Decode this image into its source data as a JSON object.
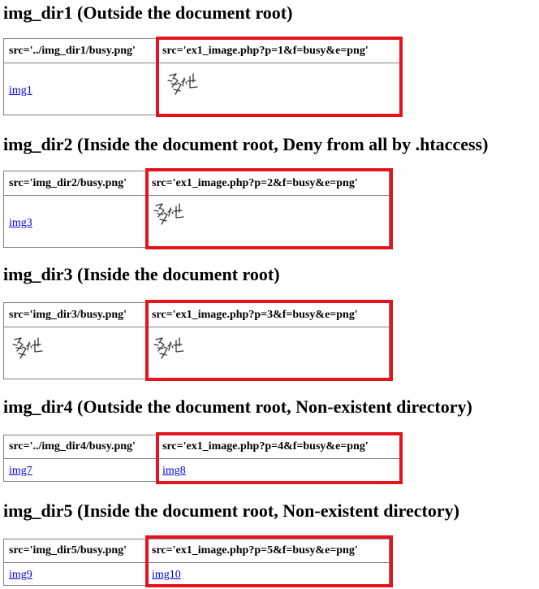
{
  "sections": [
    {
      "heading": "img_dir1 (Outside the document root)",
      "col1_header": "src='../img_dir1/busy.png'",
      "col2_header": "src='ex1_image.php?p=1&f=busy&e=png'",
      "col1_link": "img1",
      "col2_image": "busy-glyph-image"
    },
    {
      "heading": "img_dir2 (Inside the document root, Deny from all by .htaccess)",
      "col1_header": "src='img_dir2/busy.png'",
      "col2_header": "src='ex1_image.php?p=2&f=busy&e=png'",
      "col1_link": "img3",
      "col2_image": "busy-glyph-image"
    },
    {
      "heading": "img_dir3 (Inside the document root)",
      "col1_header": "src='img_dir3/busy.png'",
      "col2_header": "src='ex1_image.php?p=3&f=busy&e=png'",
      "col1_image": "busy-glyph-image",
      "col2_image": "busy-glyph-image"
    },
    {
      "heading": "img_dir4 (Outside the document root, Non-existent directory)",
      "col1_header": "src='../img_dir4/busy.png'",
      "col2_header": "src='ex1_image.php?p=4&f=busy&e=png'",
      "col1_link": "img7",
      "col2_link": "img8"
    },
    {
      "heading": "img_dir5 (Inside the document root, Non-existent directory)",
      "col1_header": "src='img_dir5/busy.png'",
      "col2_header": "src='ex1_image.php?p=5&f=busy&e=png'",
      "col1_link": "img9",
      "col2_link": "img10"
    }
  ],
  "highlight_color": "#e4141e",
  "link_color": "#0000ee"
}
